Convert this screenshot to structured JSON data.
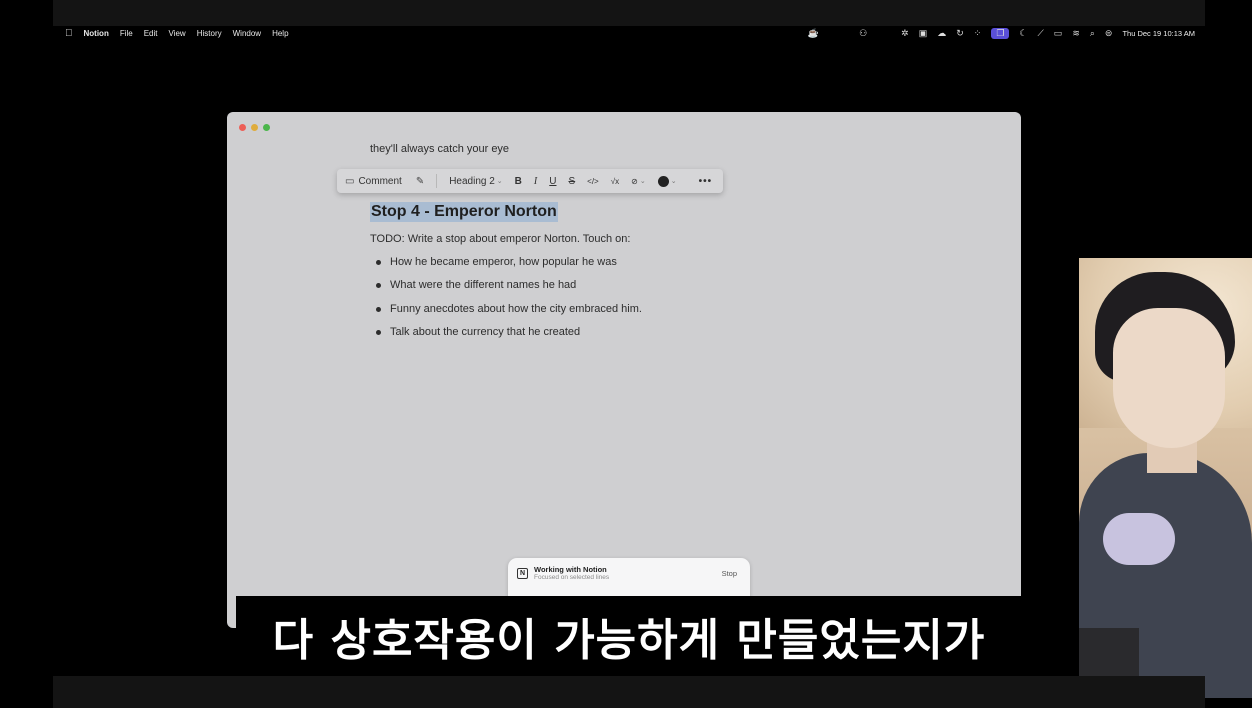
{
  "menubar": {
    "apple_icon": "apple-icon",
    "app_name": "Notion",
    "menus": [
      "File",
      "Edit",
      "View",
      "History",
      "Window",
      "Help"
    ],
    "datetime": "Thu Dec 19  10:13 AM"
  },
  "window": {
    "previous_line": "they'll always catch your eye",
    "toolbar": {
      "comment_label": "Comment",
      "block_type": "Heading 2",
      "bold": "B",
      "italic": "I",
      "underline": "U",
      "strikethrough": "S",
      "code": "</>",
      "equation": "√x",
      "link": "⊘",
      "more": "•••",
      "text_color": "#222222"
    },
    "heading": "Stop 4 - Emperor Norton",
    "todo": "TODO: Write a stop about emperor Norton. Touch on:",
    "bullets": [
      "How he became emperor, how popular he was",
      "What were the different names he had",
      "Funny anecdotes about how the city embraced him.",
      "Talk about the currency that he created"
    ]
  },
  "ai_panel": {
    "title": "Working with Notion",
    "subtitle": "Focused on selected lines",
    "stop_label": "Stop"
  },
  "caption": "다 상호작용이 가능하게 만들었는지가",
  "colors": {
    "selection": "#a9bcd2",
    "menubar_active": "#5a4fd8",
    "window_bg": "#cfcfd1"
  }
}
